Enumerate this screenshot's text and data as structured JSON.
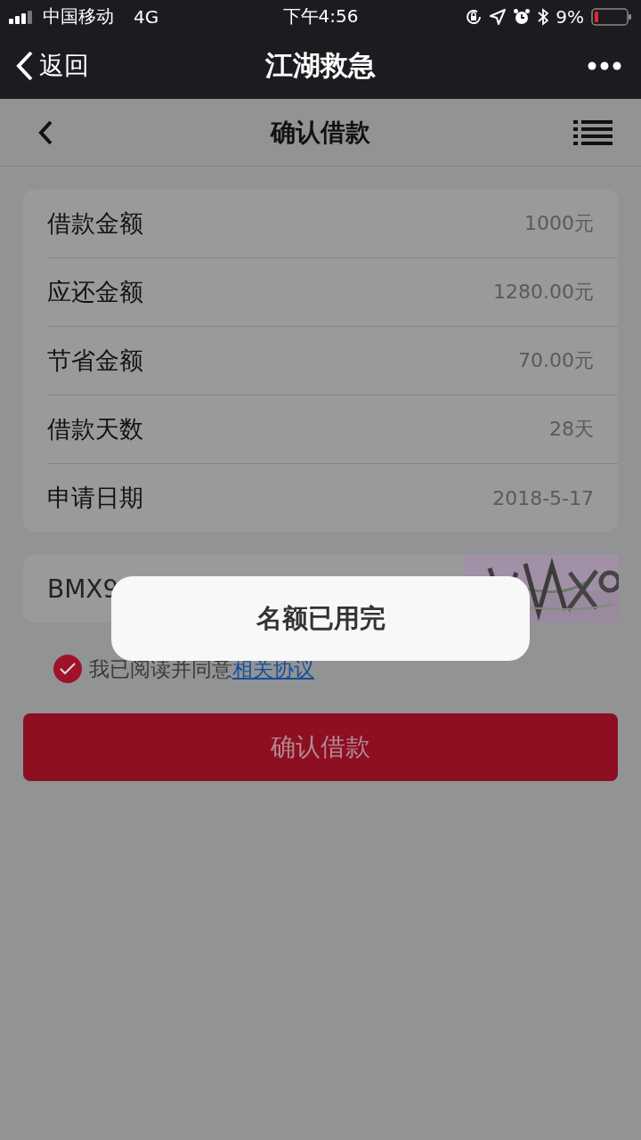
{
  "status_bar": {
    "carrier": "中国移动",
    "network": "4G",
    "time": "下午4:56",
    "battery": "9%"
  },
  "wechat_bar": {
    "back": "返回",
    "title": "江湖救急"
  },
  "page_header": {
    "title": "确认借款"
  },
  "details": [
    {
      "label": "借款金额",
      "value": "1000元"
    },
    {
      "label": "应还金额",
      "value": "1280.00元"
    },
    {
      "label": "节省金额",
      "value": "70.00元"
    },
    {
      "label": "借款天数",
      "value": "28天"
    },
    {
      "label": "申请日期",
      "value": "2018-5-17"
    }
  ],
  "captcha": {
    "value": "BMX9"
  },
  "agreement": {
    "checked": true,
    "text": "我已阅读并同意",
    "link": "相关协议"
  },
  "submit_button": "确认借款",
  "toast": "名额已用完"
}
